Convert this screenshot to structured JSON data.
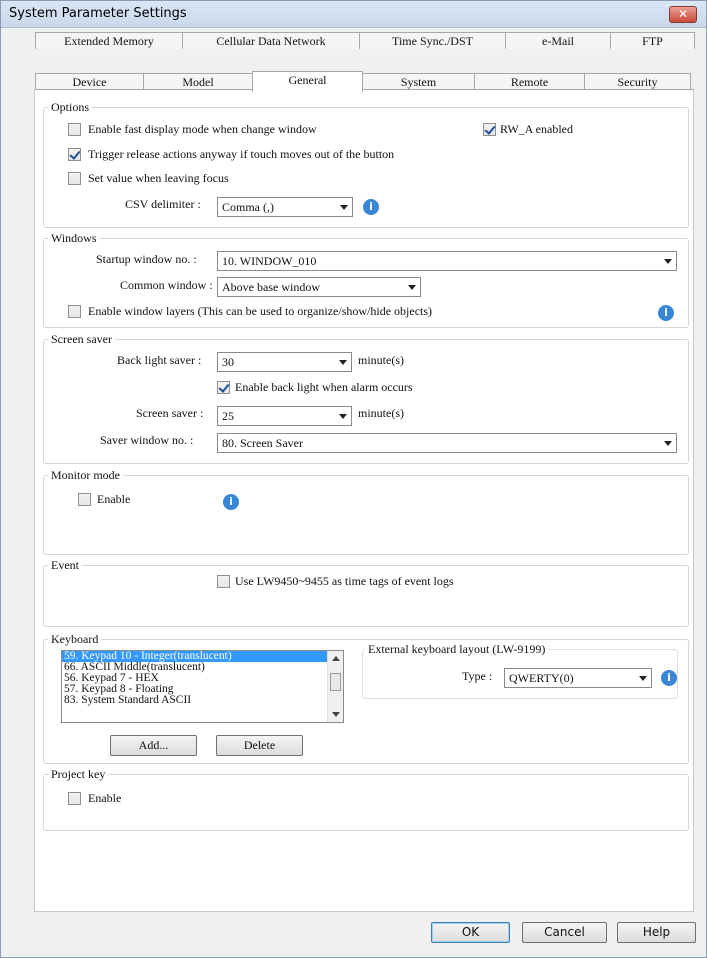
{
  "window": {
    "title": "System Parameter Settings",
    "close_label": "✕"
  },
  "tabs": {
    "row1": [
      "Extended Memory",
      "Cellular Data Network",
      "Time Sync./DST",
      "e-Mail",
      "FTP"
    ],
    "row2": [
      "Device",
      "Model",
      "General",
      "System",
      "Remote",
      "Security"
    ],
    "active": "General"
  },
  "options": {
    "title": "Options",
    "fast_display": {
      "label": "Enable fast display mode when change window",
      "checked": false
    },
    "rw_a": {
      "label": "RW_A enabled",
      "checked": true
    },
    "trigger_release": {
      "label": "Trigger release actions anyway if touch moves out of the button",
      "checked": true
    },
    "set_value_leaving": {
      "label": "Set value when leaving focus",
      "checked": false
    },
    "csv_delimiter": {
      "label": "CSV delimiter :",
      "value": "Comma (,)"
    }
  },
  "windows": {
    "title": "Windows",
    "startup": {
      "label": "Startup window no. :",
      "value": "10. WINDOW_010"
    },
    "common": {
      "label": "Common window :",
      "value": "Above base window"
    },
    "layers": {
      "label": "Enable window layers (This can be used to organize/show/hide objects)",
      "checked": false
    }
  },
  "screen_saver": {
    "title": "Screen saver",
    "back_light": {
      "label": "Back light saver :",
      "value": "30",
      "unit": "minute(s)"
    },
    "alarm": {
      "label": "Enable back light when alarm occurs",
      "checked": true
    },
    "saver": {
      "label": "Screen saver :",
      "value": "25",
      "unit": "minute(s)"
    },
    "saver_window": {
      "label": "Saver window no. :",
      "value": "80. Screen Saver"
    }
  },
  "monitor_mode": {
    "title": "Monitor mode",
    "enable": {
      "label": "Enable",
      "checked": false
    }
  },
  "event": {
    "title": "Event",
    "use_lw": {
      "label": "Use LW9450~9455 as time tags of event logs",
      "checked": false
    }
  },
  "keyboard": {
    "title": "Keyboard",
    "items": [
      "59. Keypad 10 - Integer(translucent)",
      "66. ASCII Middle(translucent)",
      "56. Keypad 7 - HEX",
      "57. Keypad 8 - Floating",
      "83. System Standard ASCII"
    ],
    "add_label": "Add...",
    "delete_label": "Delete",
    "external_title": "External keyboard layout (LW-9199)",
    "type_label": "Type :",
    "type_value": "QWERTY(0)"
  },
  "project_key": {
    "title": "Project key",
    "enable": {
      "label": "Enable",
      "checked": false
    }
  },
  "footer": {
    "ok": "OK",
    "cancel": "Cancel",
    "help": "Help"
  }
}
